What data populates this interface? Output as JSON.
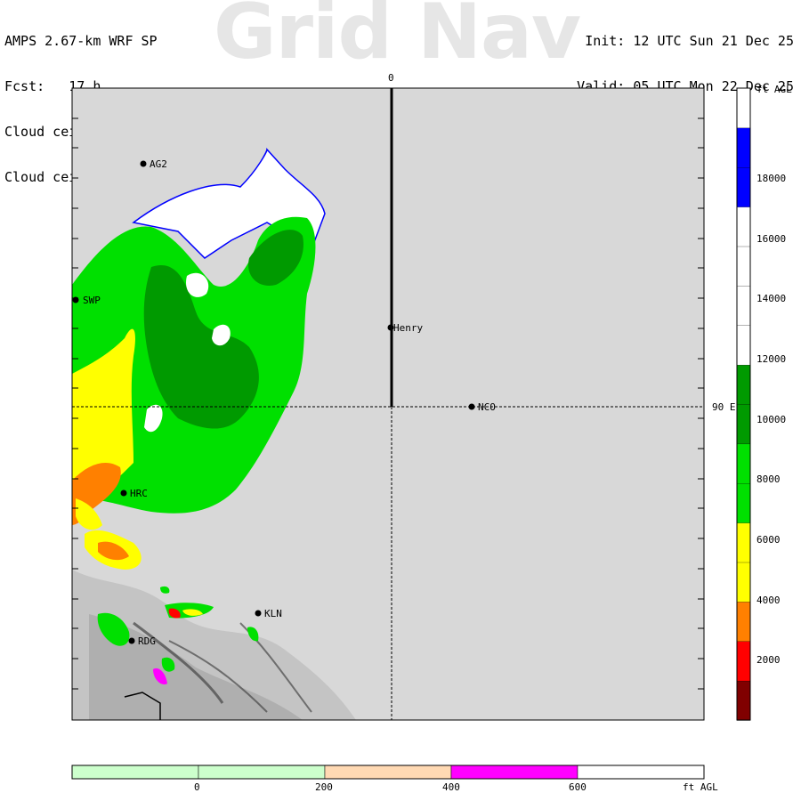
{
  "header": {
    "model": "AMPS 2.67-km WRF SP",
    "forecast": "Fcst:   17 h",
    "field_1": "Cloud ceiling (ft AGL)",
    "field_2": "Cloud ceiling (ft AGL)",
    "init": "Init: 12 UTC Sun 21 Dec 25",
    "valid": "Valid: 05 UTC Mon 22 Dec 25"
  },
  "watermark": "Grid Nav",
  "map": {
    "top_label": "0",
    "right_label": "90 E",
    "stations": [
      {
        "id": "AG2",
        "label": "AG2"
      },
      {
        "id": "SWP",
        "label": "SWP"
      },
      {
        "id": "Henry",
        "label": "Henry"
      },
      {
        "id": "NCO",
        "label": "NCO"
      },
      {
        "id": "HRC",
        "label": "HRC"
      },
      {
        "id": "KLN",
        "label": "KLN"
      },
      {
        "id": "RDG",
        "label": "RDG"
      }
    ],
    "colors": {
      "background": "#d8d8d8",
      "white": "#ffffff",
      "light_green": "#00e000",
      "dark_green": "#009a00",
      "yellow": "#ffff00",
      "orange": "#ff8000",
      "red": "#ff0000",
      "blue": "#0000ff",
      "magenta": "#ff00ff"
    }
  },
  "colorbar": {
    "units": "ft AGL",
    "ticks": [
      "18000",
      "16000",
      "14000",
      "12000",
      "10000",
      "8000",
      "6000",
      "4000",
      "2000"
    ],
    "segments": [
      {
        "color": "#800000"
      },
      {
        "color": "#ff0000"
      },
      {
        "color": "#ff8000"
      },
      {
        "color": "#ffff00"
      },
      {
        "color": "#ffff00"
      },
      {
        "color": "#00e000"
      },
      {
        "color": "#00e000"
      },
      {
        "color": "#009a00"
      },
      {
        "color": "#009a00"
      },
      {
        "color": "#ffffff"
      },
      {
        "color": "#ffffff"
      },
      {
        "color": "#ffffff"
      },
      {
        "color": "#ffffff"
      },
      {
        "color": "#0000ff"
      },
      {
        "color": "#0000ff"
      },
      {
        "color": "#ffffff"
      }
    ]
  },
  "bottom_bar": {
    "units": "ft AGL",
    "ticks": [
      "0",
      "200",
      "400",
      "600"
    ],
    "segments": [
      {
        "color": "#ccffcc"
      },
      {
        "color": "#ccffcc"
      },
      {
        "color": "#ffd9b3"
      },
      {
        "color": "#ff00ff"
      },
      {
        "color": "#ffffff"
      }
    ]
  }
}
